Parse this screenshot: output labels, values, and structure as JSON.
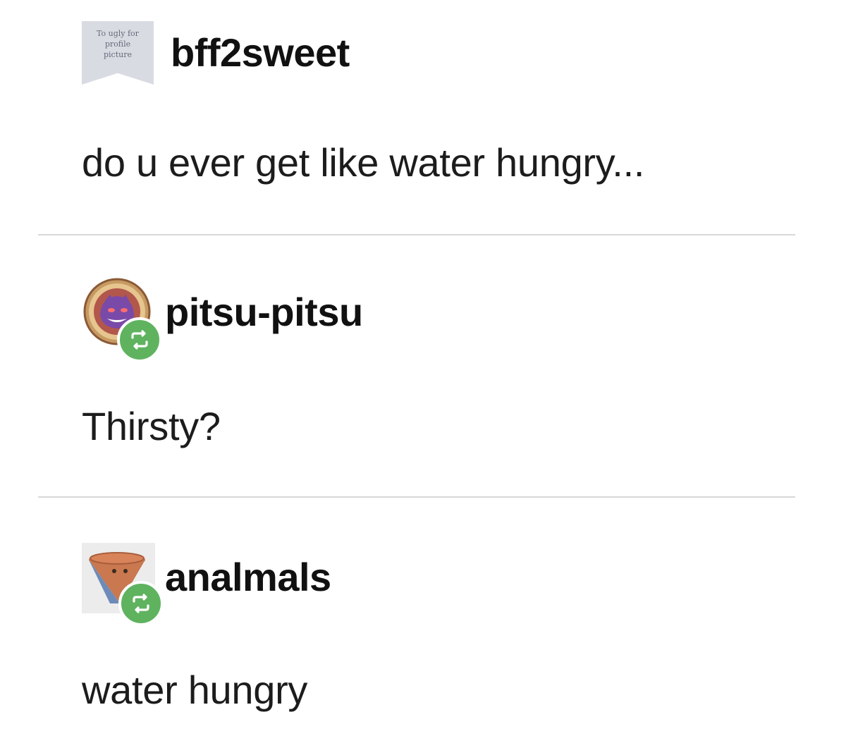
{
  "posts": [
    {
      "username": "bff2sweet",
      "avatar": {
        "kind": "placeholder",
        "text_lines": [
          "To ugly for",
          "profile",
          "picture"
        ]
      },
      "reblogged": false,
      "body": "do u ever get like water hungry..."
    },
    {
      "username": "pitsu-pitsu",
      "avatar": {
        "kind": "round-badge",
        "icon": "purple-monster-icon"
      },
      "reblogged": true,
      "body": "Thirsty?"
    },
    {
      "username": "analmals",
      "avatar": {
        "kind": "square",
        "icon": "cone-icon"
      },
      "reblogged": true,
      "body": "water hungry"
    }
  ],
  "colors": {
    "reblog_green": "#5fb35f",
    "divider": "#d8d8d8",
    "text": "#1c1c1c"
  }
}
